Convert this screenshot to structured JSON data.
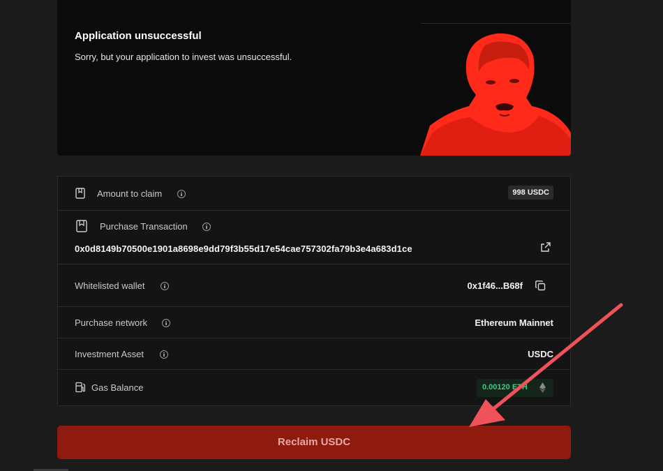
{
  "banner": {
    "title": "Application unsuccessful",
    "message": "Sorry, but your application to invest was unsuccessful."
  },
  "details": {
    "amount_to_claim": {
      "label": "Amount to claim",
      "value": "998 USDC"
    },
    "purchase_transaction": {
      "label": "Purchase Transaction",
      "hash": "0x0d8149b70500e1901a8698e9dd79f3b55d17e54cae757302fa79b3e4a683d1ce"
    },
    "whitelisted_wallet": {
      "label": "Whitelisted wallet",
      "value": "0x1f46...B68f"
    },
    "purchase_network": {
      "label": "Purchase network",
      "value": "Ethereum Mainnet"
    },
    "investment_asset": {
      "label": "Investment Asset",
      "value": "USDC"
    },
    "gas_balance": {
      "label": "Gas Balance",
      "value": "0.00120 ETH"
    }
  },
  "actions": {
    "reclaim_label": "Reclaim USDC"
  },
  "colors": {
    "accent_red": "#8f1a0e",
    "gas_green": "#33d17a",
    "annotation_arrow": "#f0525a"
  }
}
